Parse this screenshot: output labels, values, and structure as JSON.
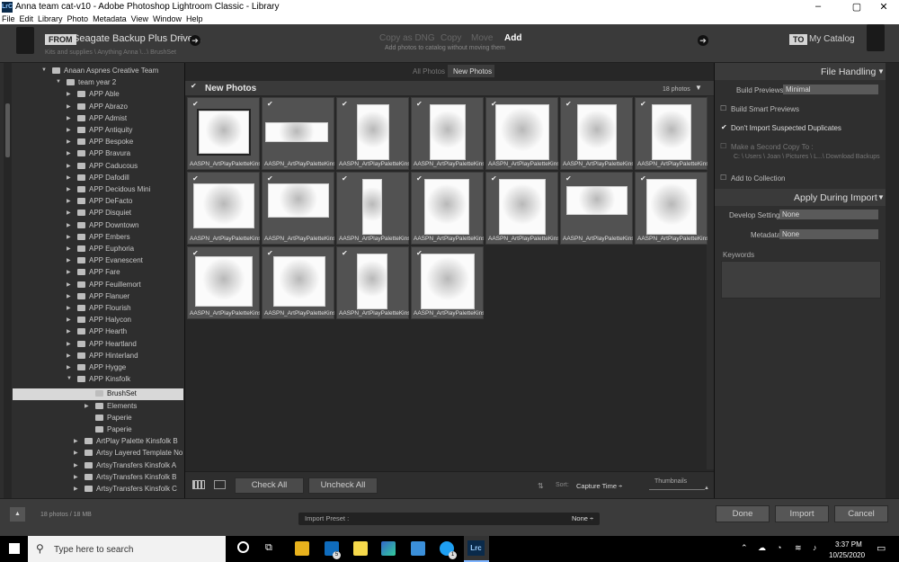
{
  "window": {
    "title": "Anna team cat-v10 - Adobe Photoshop Lightroom Classic - Library",
    "app_badge": "LrC",
    "minimize": "–",
    "maximize": "▢",
    "close": "✕"
  },
  "menu": [
    "File",
    "Edit",
    "Library",
    "Photo",
    "Metadata",
    "View",
    "Window",
    "Help"
  ],
  "import_header": {
    "from_tag": "FROM",
    "source": "Seagate Backup Plus Drive...",
    "source_caret": "÷",
    "source_path": "Kits and supplies \\ Anything Anna \\...\\ BrushSet",
    "modes": [
      "Copy as DNG",
      "Copy",
      "Move",
      "Add"
    ],
    "active_mode": "Add",
    "mode_description": "Add photos to catalog without moving them",
    "to_tag": "TO",
    "destination": "My Catalog",
    "arrow": "➔"
  },
  "folder_tree": [
    {
      "label": "Anaan Aspnes Creative Team",
      "level": 0,
      "expanded": true
    },
    {
      "label": "team year 2",
      "level": 1,
      "expanded": true
    },
    {
      "label": "APP Able",
      "level": 2
    },
    {
      "label": "APP Abrazo",
      "level": 2
    },
    {
      "label": "APP Admist",
      "level": 2
    },
    {
      "label": "APP Antiquity",
      "level": 2
    },
    {
      "label": "APP Bespoke",
      "level": 2
    },
    {
      "label": "APP Bravura",
      "level": 2
    },
    {
      "label": "APP Caducous",
      "level": 2
    },
    {
      "label": "APP Dafodill",
      "level": 2
    },
    {
      "label": "APP Decidous Mini",
      "level": 2
    },
    {
      "label": "APP DeFacto",
      "level": 2
    },
    {
      "label": "APP Disquiet",
      "level": 2
    },
    {
      "label": "APP Downtown",
      "level": 2
    },
    {
      "label": "APP Embers",
      "level": 2
    },
    {
      "label": "APP Euphoria",
      "level": 2
    },
    {
      "label": "APP Evanescent",
      "level": 2
    },
    {
      "label": "APP Fare",
      "level": 2
    },
    {
      "label": "APP Feuillemort",
      "level": 2
    },
    {
      "label": "APP Flanuer",
      "level": 2
    },
    {
      "label": "APP Flourish",
      "level": 2
    },
    {
      "label": "APP Halycon",
      "level": 2
    },
    {
      "label": "APP Hearth",
      "level": 2
    },
    {
      "label": "APP Heartland",
      "level": 2
    },
    {
      "label": "APP Hinterland",
      "level": 2
    },
    {
      "label": "APP Hygge",
      "level": 2
    },
    {
      "label": "APP Kinsfolk",
      "level": 2,
      "expanded": true
    }
  ],
  "folder_selected": "BrushSet",
  "folder_subitems": [
    "Elements",
    "Paperie",
    "Paperie"
  ],
  "folder_tree_tail": [
    "ArtPlay Palette Kinsfolk B",
    "Artsy Layered Template No 2...",
    "ArtsyTransfers Kinsfolk A",
    "ArtsyTransfers Kinsfolk B",
    "ArtsyTransfers Kinsfolk C"
  ],
  "grid": {
    "filter_tabs": [
      "All Photos",
      "New Photos"
    ],
    "active_filter": "New Photos",
    "section_title": "New Photos",
    "section_count": "18 photos",
    "check": "✔",
    "filename": "AASPN_ArtPlayPaletteKins...",
    "photo_count": 18,
    "check_all": "Check All",
    "uncheck_all": "Uncheck All",
    "sort_label": "Sort:",
    "sort_value": "Capture Time ÷",
    "thumbnails_label": "Thumbnails"
  },
  "right_panel": {
    "file_handling_title": "File Handling",
    "build_previews_label": "Build Previews",
    "build_previews_value": "Minimal",
    "build_smart_previews": "Build Smart Previews",
    "dont_import_duplicates": "Don't Import Suspected Duplicates",
    "make_second_copy": "Make a Second Copy To :",
    "second_copy_path": "C: \\ Users \\ Joan \\ Pictures \\ L...\\ Download Backups",
    "add_to_collection": "Add to Collection",
    "apply_title": "Apply During Import",
    "develop_settings_label": "Develop Settings",
    "develop_settings_value": "None",
    "metadata_label": "Metadata",
    "metadata_value": "None",
    "keywords_label": "Keywords"
  },
  "bottom": {
    "status": "18 photos / 18 MB",
    "import_preset_label": "Import Preset :",
    "import_preset_value": "None ÷",
    "done": "Done",
    "import": "Import",
    "cancel": "Cancel"
  },
  "taskbar": {
    "search_placeholder": "Type here to search",
    "time": "3:37 PM",
    "date": "10/25/2020",
    "mail_badge": "5",
    "skype_badge": "1",
    "lrc_label": "Lrc"
  }
}
